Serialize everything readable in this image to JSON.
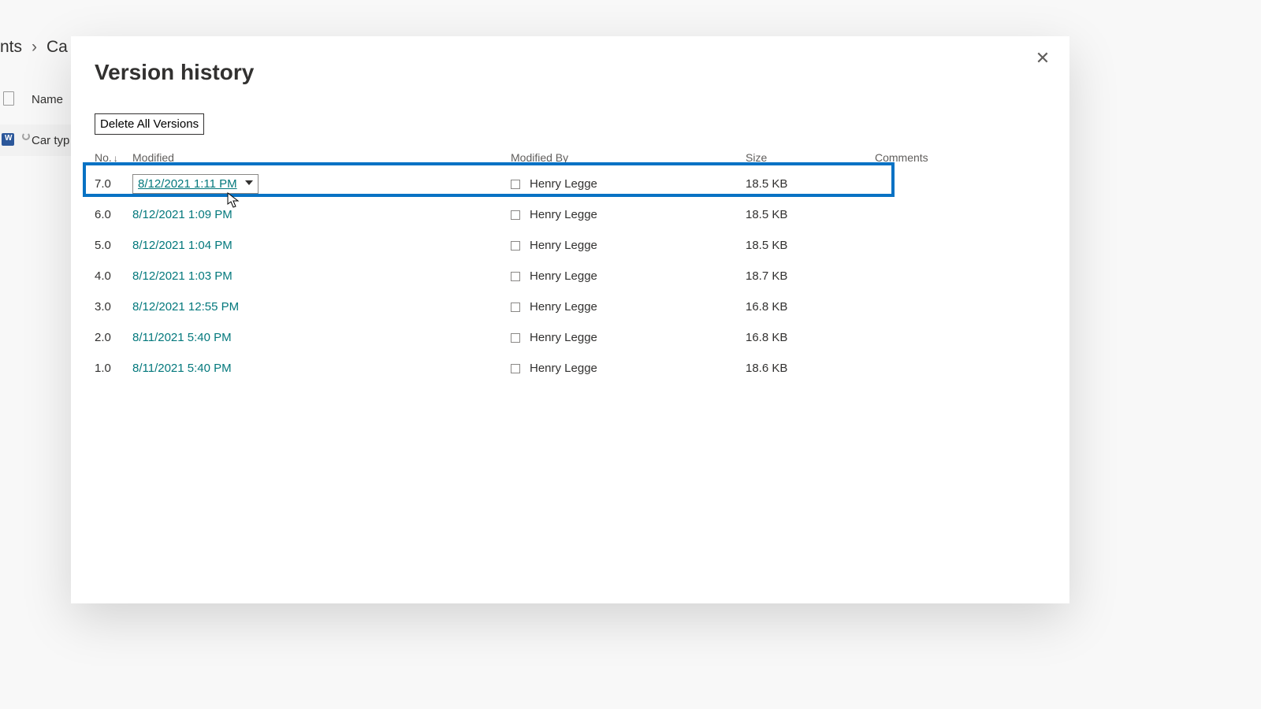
{
  "breadcrumb": {
    "segment1": "nts",
    "segment2": "Ca"
  },
  "background": {
    "header_name": "Name",
    "file_name": "Car typ"
  },
  "modal": {
    "title": "Version history",
    "delete_all": "Delete All Versions",
    "columns": {
      "no": "No.",
      "modified": "Modified",
      "modified_by": "Modified By",
      "size": "Size",
      "comments": "Comments"
    },
    "rows": [
      {
        "no": "7.0",
        "modified": "8/12/2021 1:11 PM",
        "modified_by": "Henry Legge",
        "size": "18.5 KB",
        "comments": "",
        "selected": true,
        "dropdown": true
      },
      {
        "no": "6.0",
        "modified": "8/12/2021 1:09 PM",
        "modified_by": "Henry Legge",
        "size": "18.5 KB",
        "comments": ""
      },
      {
        "no": "5.0",
        "modified": "8/12/2021 1:04 PM",
        "modified_by": "Henry Legge",
        "size": "18.5 KB",
        "comments": ""
      },
      {
        "no": "4.0",
        "modified": "8/12/2021 1:03 PM",
        "modified_by": "Henry Legge",
        "size": "18.7 KB",
        "comments": ""
      },
      {
        "no": "3.0",
        "modified": "8/12/2021 12:55 PM",
        "modified_by": "Henry Legge",
        "size": "16.8 KB",
        "comments": ""
      },
      {
        "no": "2.0",
        "modified": "8/11/2021 5:40 PM",
        "modified_by": "Henry Legge",
        "size": "16.8 KB",
        "comments": ""
      },
      {
        "no": "1.0",
        "modified": "8/11/2021 5:40 PM",
        "modified_by": "Henry Legge",
        "size": "18.6 KB",
        "comments": ""
      }
    ]
  }
}
